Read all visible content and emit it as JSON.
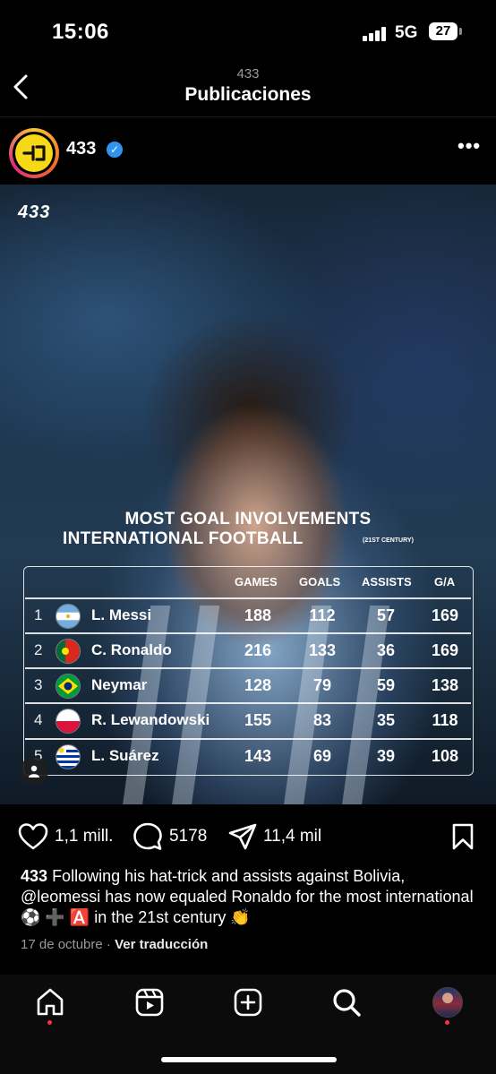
{
  "status": {
    "time": "15:06",
    "network": "5G",
    "battery": "27"
  },
  "header": {
    "account": "433",
    "title": "Publicaciones"
  },
  "post": {
    "username": "433",
    "image": {
      "brand": "433",
      "headline_line1": "MOST GOAL INVOLVEMENTS",
      "headline_line2": "INTERNATIONAL FOOTBALL",
      "headline_note": "(21ST CENTURY)",
      "columns": [
        "GAMES",
        "GOALS",
        "ASSISTS",
        "G/A"
      ],
      "rows": [
        {
          "rank": "1",
          "flag": "argentina",
          "name": "L. Messi",
          "games": "188",
          "goals": "112",
          "assists": "57",
          "ga": "169"
        },
        {
          "rank": "2",
          "flag": "portugal",
          "name": "C. Ronaldo",
          "games": "216",
          "goals": "133",
          "assists": "36",
          "ga": "169"
        },
        {
          "rank": "3",
          "flag": "brazil",
          "name": "Neymar",
          "games": "128",
          "goals": "79",
          "assists": "59",
          "ga": "138"
        },
        {
          "rank": "4",
          "flag": "poland",
          "name": "R. Lewandowski",
          "games": "155",
          "goals": "83",
          "assists": "35",
          "ga": "118"
        },
        {
          "rank": "5",
          "flag": "uruguay",
          "name": "L. Suárez",
          "games": "143",
          "goals": "69",
          "assists": "39",
          "ga": "108"
        }
      ]
    },
    "likes": "1,1 mill.",
    "comments": "5178",
    "shares": "11,4 mil",
    "caption_user": "433",
    "caption_text": "Following his hat-trick and assists against Bolivia, @leomessi has now equaled Ronaldo for the most international ⚽ ➕ 🅰️ in the 21st century 👏",
    "date": "17 de octubre",
    "separator": "·",
    "translate": "Ver traducción"
  },
  "icons": [
    "back-chevron-icon",
    "verified-icon",
    "more-icon",
    "heart-icon",
    "comment-icon",
    "share-icon",
    "bookmark-icon",
    "home-icon",
    "reels-icon",
    "create-icon",
    "search-icon",
    "profile-avatar"
  ],
  "colors": {
    "verified": "#2f93f0",
    "avatar_bg": "#f7d816",
    "notification_dot": "#ff3040"
  }
}
